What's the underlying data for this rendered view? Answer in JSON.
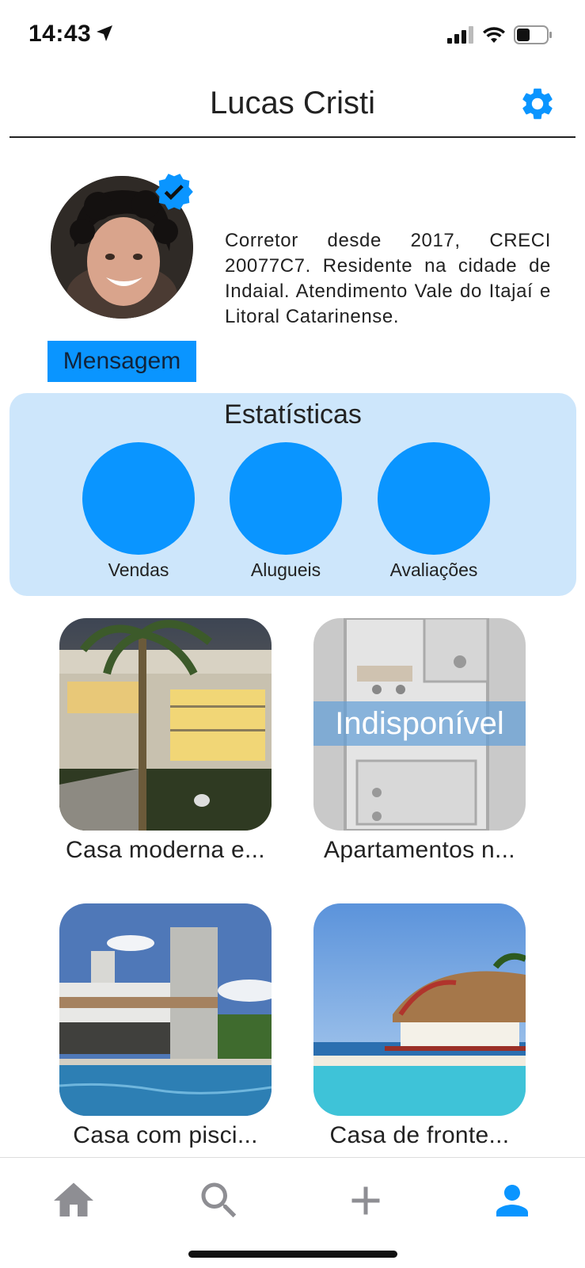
{
  "status": {
    "time": "14:43"
  },
  "header": {
    "title": "Lucas Cristi"
  },
  "profile": {
    "bio": "Corretor desde 2017, CRECI 20077C7. Residente na cidade de Indaial. Atendimento Vale do Itajaí e Litoral Catarinense.",
    "message_button": "Mensagem"
  },
  "stats": {
    "title": "Estatísticas",
    "items": [
      {
        "label": "Vendas"
      },
      {
        "label": "Alugueis"
      },
      {
        "label": "Avaliações"
      }
    ]
  },
  "listings": [
    {
      "title": "Casa moderna e..."
    },
    {
      "title": "Apartamentos n...",
      "badge": "Indisponível"
    },
    {
      "title": "Casa com pisci..."
    },
    {
      "title": "Casa de fronte..."
    }
  ],
  "tabs": [
    {
      "icon": "home-icon"
    },
    {
      "icon": "search-icon"
    },
    {
      "icon": "plus-icon"
    },
    {
      "icon": "person-icon"
    }
  ],
  "colors": {
    "accent": "#0a95ff",
    "stats_bg": "#cde6fb",
    "tab_inactive": "#8e8e93"
  }
}
